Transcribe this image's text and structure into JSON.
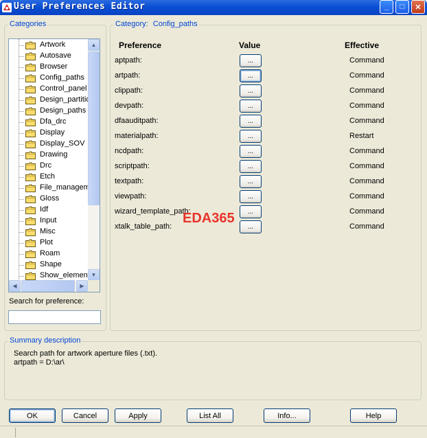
{
  "window": {
    "title": "User Preferences Editor",
    "minimize": "_",
    "maximize": "□",
    "close": "✕"
  },
  "categories": {
    "legend": "Categories",
    "items": [
      "Artwork",
      "Autosave",
      "Browser",
      "Config_paths",
      "Control_panel",
      "Design_partition",
      "Design_paths",
      "Dfa_drc",
      "Display",
      "Display_SOV",
      "Drawing",
      "Drc",
      "Etch",
      "File_management",
      "Gloss",
      "Idf",
      "Input",
      "Misc",
      "Plot",
      "Roam",
      "Shape",
      "Show_elements"
    ],
    "selected": "Config_paths",
    "search_label": "Search for preference:",
    "search_value": ""
  },
  "config": {
    "legend_prefix": "Category:",
    "legend_value": "Config_paths",
    "col_preference": "Preference",
    "col_value": "Value",
    "col_effective": "Effective",
    "value_button_label": "...",
    "rows": [
      {
        "name": "aptpath:",
        "effective": "Command"
      },
      {
        "name": "artpath:",
        "effective": "Command"
      },
      {
        "name": "clippath:",
        "effective": "Command"
      },
      {
        "name": "devpath:",
        "effective": "Command"
      },
      {
        "name": "dfaauditpath:",
        "effective": "Command"
      },
      {
        "name": "materialpath:",
        "effective": "Restart"
      },
      {
        "name": "ncdpath:",
        "effective": "Command"
      },
      {
        "name": "scriptpath:",
        "effective": "Command"
      },
      {
        "name": "textpath:",
        "effective": "Command"
      },
      {
        "name": "viewpath:",
        "effective": "Command"
      },
      {
        "name": "wizard_template_path:",
        "effective": "Command"
      },
      {
        "name": "xtalk_table_path:",
        "effective": "Command"
      }
    ]
  },
  "watermark": "EDA365",
  "summary": {
    "legend": "Summary description",
    "line1": "Search path for artwork aperture files (.txt).",
    "line2": "artpath = D:\\ar\\"
  },
  "buttons": {
    "ok": "OK",
    "cancel": "Cancel",
    "apply": "Apply",
    "list_all": "List All",
    "info": "Info...",
    "help": "Help"
  },
  "colors": {
    "titlebar": "#0A4FD6",
    "legend_text": "#0046D5",
    "watermark": "#E8332A",
    "dialog_bg": "#ECE9D8"
  }
}
